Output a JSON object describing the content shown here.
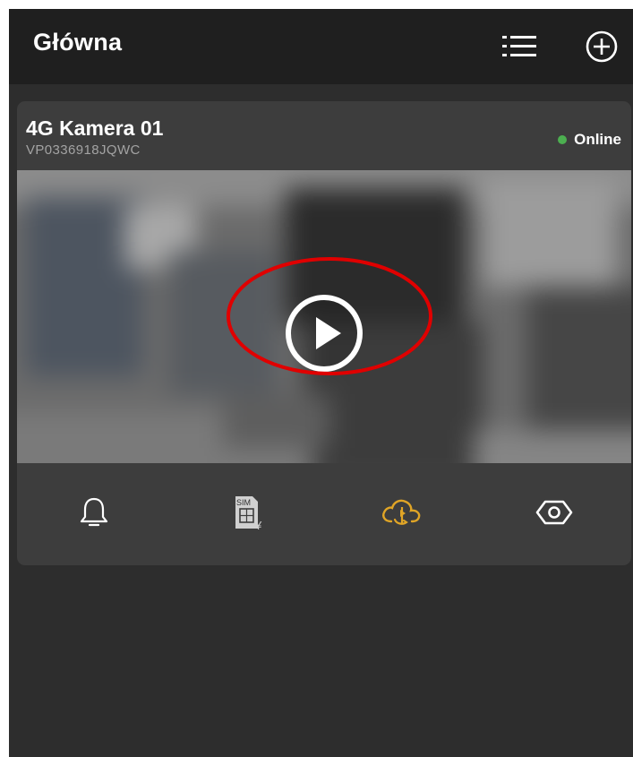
{
  "header": {
    "title": "Główna",
    "list_icon": "list-icon",
    "add_icon": "add-circle-icon"
  },
  "device": {
    "name": "4G Kamera 01",
    "serial": "VP0336918JQWC",
    "status": "Online",
    "status_color": "#4caf50",
    "play_icon": "play-circle-icon"
  },
  "actions": [
    {
      "icon": "bell-icon"
    },
    {
      "icon": "sim-card-icon",
      "badge": "SIM",
      "currency": "¥"
    },
    {
      "icon": "cloud-playback-icon",
      "color": "#e0a526"
    },
    {
      "icon": "eye-icon"
    }
  ],
  "colors": {
    "header_bg": "#1f1f1f",
    "screen_bg": "#2d2d2d",
    "card_bg": "#3d3d3d",
    "highlight": "#e00000"
  }
}
